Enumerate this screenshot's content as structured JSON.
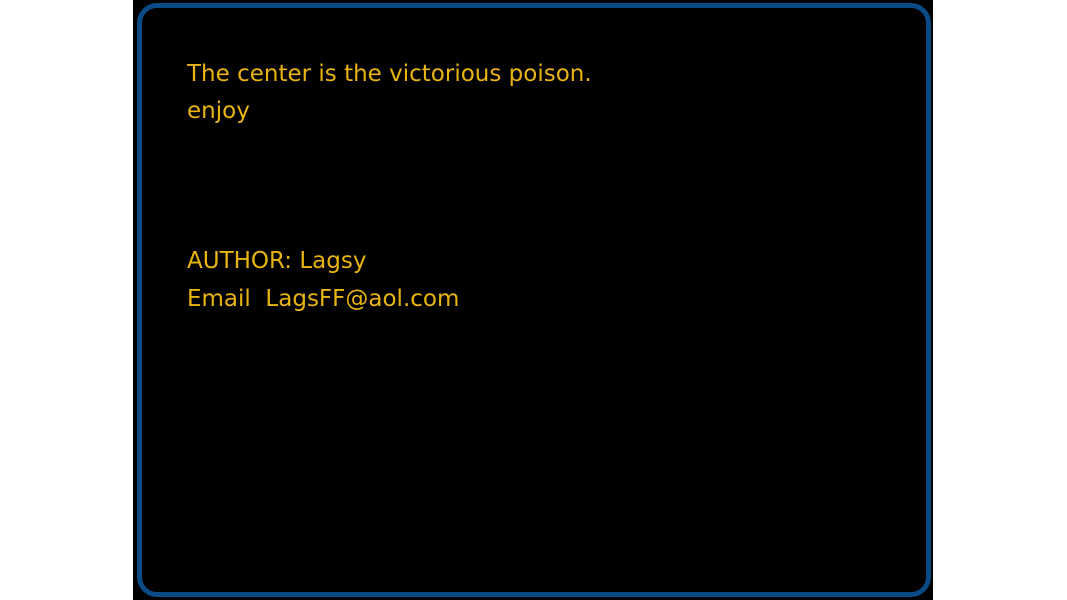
{
  "message": {
    "line1": "The center is the victorious poison.",
    "line2": "enjoy"
  },
  "credits": {
    "author": "AUTHOR: Lagsy",
    "email": "Email  LagsFF@aol.com"
  },
  "colors": {
    "text": "#e8b412",
    "border": "#0a4a85",
    "background": "#000000"
  }
}
